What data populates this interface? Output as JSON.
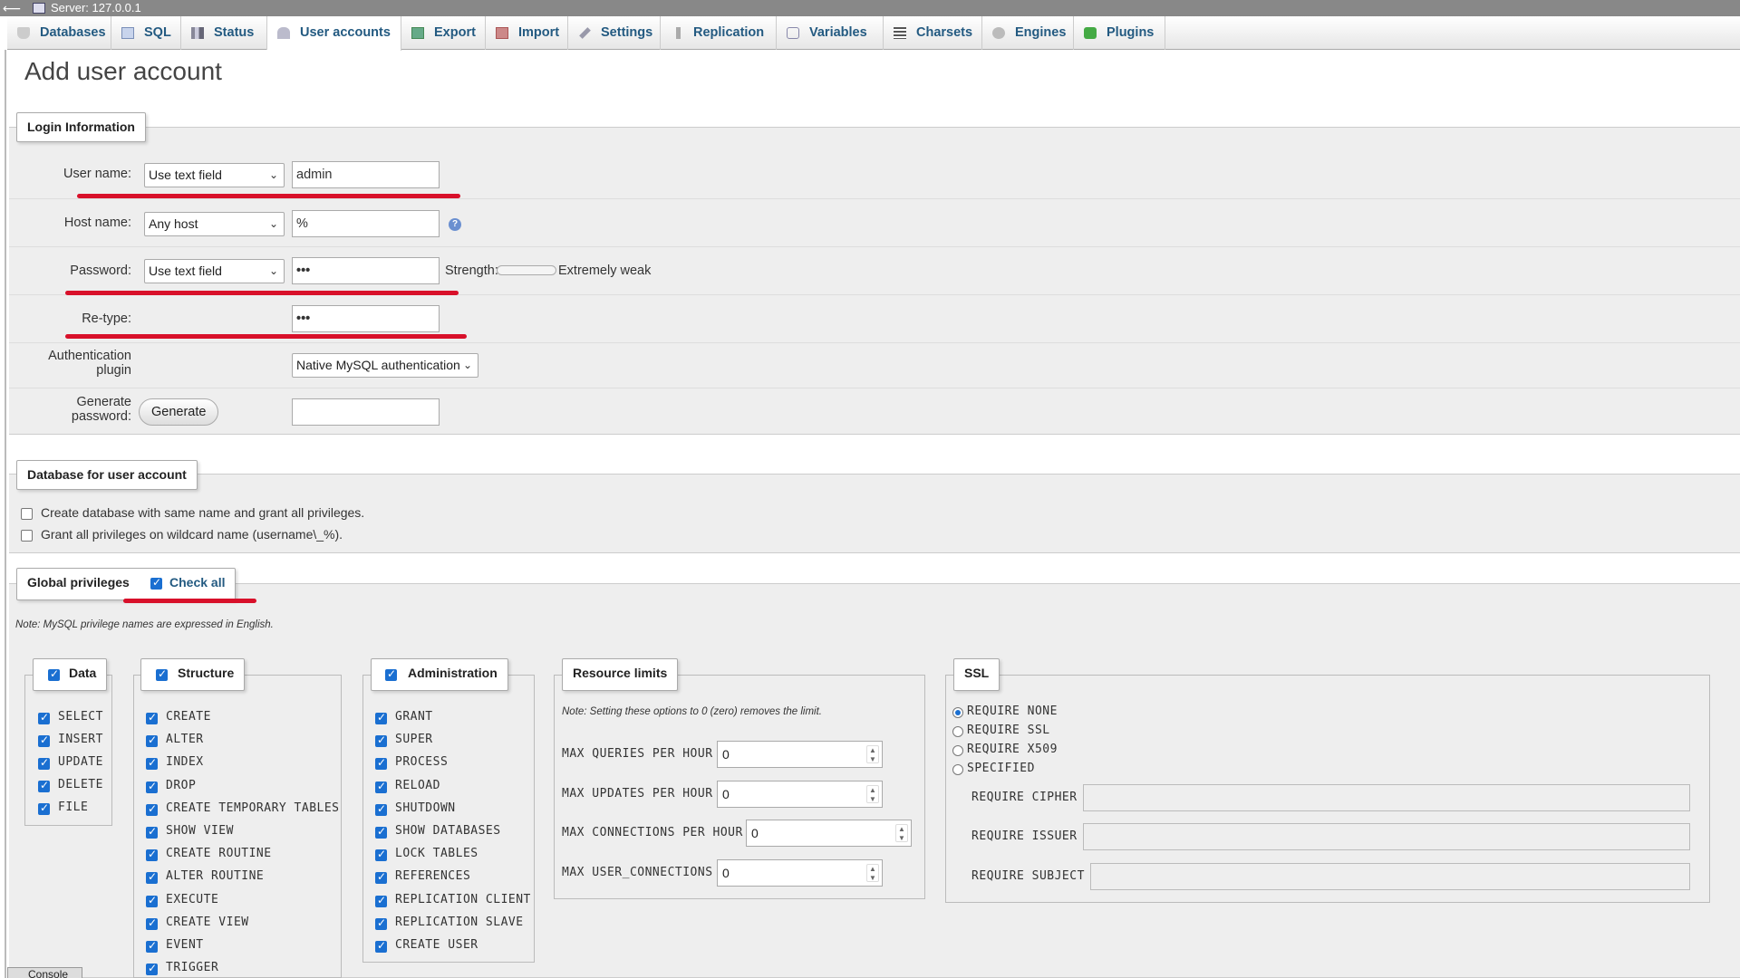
{
  "server_bar": {
    "label": "Server: 127.0.0.1"
  },
  "tabs": [
    {
      "label": "Databases",
      "icon": "database-icon"
    },
    {
      "label": "SQL",
      "icon": "sql-icon"
    },
    {
      "label": "Status",
      "icon": "status-icon"
    },
    {
      "label": "User accounts",
      "icon": "users-icon",
      "active": true
    },
    {
      "label": "Export",
      "icon": "export-icon"
    },
    {
      "label": "Import",
      "icon": "import-icon"
    },
    {
      "label": "Settings",
      "icon": "wrench-icon"
    },
    {
      "label": "Replication",
      "icon": "replication-icon"
    },
    {
      "label": "Variables",
      "icon": "variables-icon"
    },
    {
      "label": "Charsets",
      "icon": "charsets-icon"
    },
    {
      "label": "Engines",
      "icon": "engines-icon"
    },
    {
      "label": "Plugins",
      "icon": "plugin-icon"
    }
  ],
  "page_title": "Add user account",
  "login": {
    "legend": "Login Information",
    "user_name": {
      "label": "User name:",
      "select": "Use text field",
      "value": "admin"
    },
    "host_name": {
      "label": "Host name:",
      "select": "Any host",
      "value": "%"
    },
    "password": {
      "label": "Password:",
      "select": "Use text field",
      "value": "•••",
      "strength_label": "Strength:",
      "strength_text": "Extremely weak"
    },
    "retype": {
      "label": "Re-type:",
      "value": "•••"
    },
    "auth": {
      "label_line1": "Authentication",
      "label_line2": "plugin",
      "select": "Native MySQL authentication"
    },
    "generate": {
      "label_line1": "Generate",
      "label_line2": "password:",
      "button": "Generate",
      "value": ""
    }
  },
  "database": {
    "legend": "Database for user account",
    "opt1": "Create database with same name and grant all privileges.",
    "opt2": "Grant all privileges on wildcard name (username\\_%)."
  },
  "global": {
    "legend": "Global privileges",
    "check_all": "Check all",
    "note": "Note: MySQL privilege names are expressed in English."
  },
  "data_group": {
    "title": "Data",
    "items": [
      "SELECT",
      "INSERT",
      "UPDATE",
      "DELETE",
      "FILE"
    ]
  },
  "structure_group": {
    "title": "Structure",
    "items": [
      "CREATE",
      "ALTER",
      "INDEX",
      "DROP",
      "CREATE TEMPORARY TABLES",
      "SHOW VIEW",
      "CREATE ROUTINE",
      "ALTER ROUTINE",
      "EXECUTE",
      "CREATE VIEW",
      "EVENT",
      "TRIGGER"
    ]
  },
  "admin_group": {
    "title": "Administration",
    "items": [
      "GRANT",
      "SUPER",
      "PROCESS",
      "RELOAD",
      "SHUTDOWN",
      "SHOW DATABASES",
      "LOCK TABLES",
      "REFERENCES",
      "REPLICATION CLIENT",
      "REPLICATION SLAVE",
      "CREATE USER"
    ]
  },
  "resource": {
    "title": "Resource limits",
    "note": "Note: Setting these options to 0 (zero) removes the limit.",
    "rows": [
      {
        "label": "MAX QUERIES PER HOUR",
        "value": "0"
      },
      {
        "label": "MAX UPDATES PER HOUR",
        "value": "0"
      },
      {
        "label": "MAX CONNECTIONS PER HOUR",
        "value": "0"
      },
      {
        "label": "MAX USER_CONNECTIONS",
        "value": "0"
      }
    ]
  },
  "ssl": {
    "title": "SSL",
    "options": [
      "REQUIRE NONE",
      "REQUIRE SSL",
      "REQUIRE X509",
      "SPECIFIED"
    ],
    "selected": "REQUIRE NONE",
    "fields": [
      "REQUIRE CIPHER",
      "REQUIRE ISSUER",
      "REQUIRE SUBJECT"
    ]
  },
  "console": {
    "label": "Console"
  },
  "colors": {
    "link": "#235a81",
    "annotation_red": "#d8102a",
    "check_blue": "#1a6fd1"
  }
}
